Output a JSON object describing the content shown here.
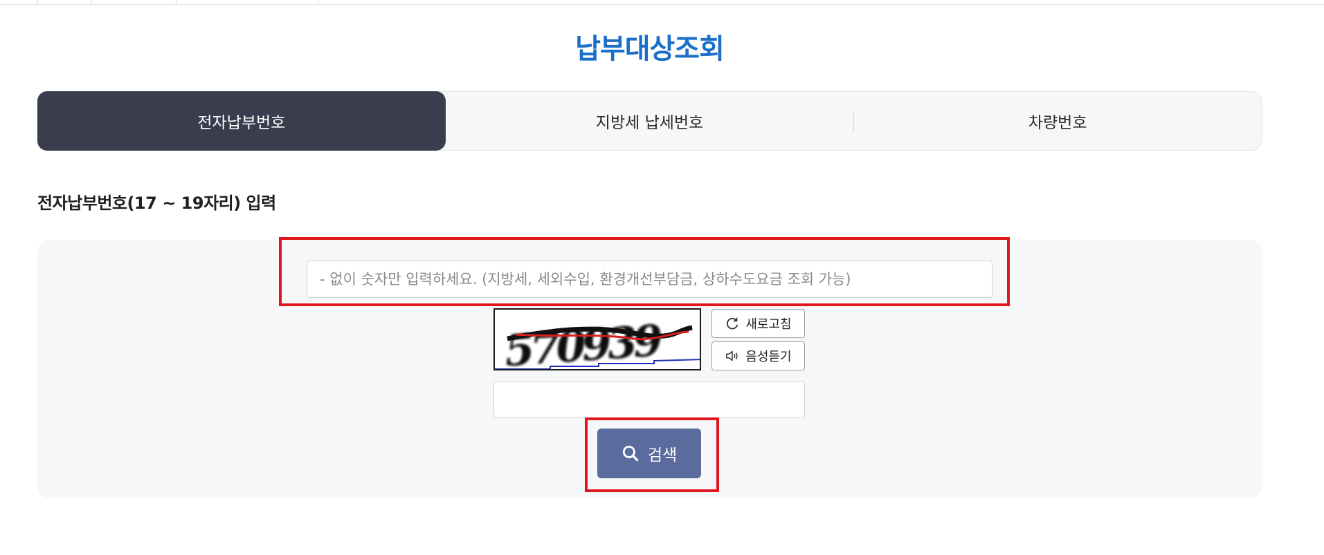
{
  "page": {
    "title": "납부대상조회"
  },
  "tabs": [
    {
      "label": "전자납부번호",
      "active": true
    },
    {
      "label": "지방세 납세번호",
      "active": false
    },
    {
      "label": "차량번호",
      "active": false
    }
  ],
  "form": {
    "section_label": "전자납부번호(17 ~ 19자리) 입력",
    "number_input": {
      "placeholder": "- 없이 숫자만 입력하세요. (지방세, 세외수입, 환경개선부담금, 상하수도요금 조회 가능)",
      "value": ""
    },
    "captcha": {
      "image_text": "570939",
      "refresh_label": "새로고침",
      "refresh_icon": "refresh-icon",
      "audio_label": "음성듣기",
      "audio_icon": "speaker-icon",
      "answer_value": ""
    },
    "search_button": {
      "label": "검색",
      "icon": "search-icon"
    }
  },
  "colors": {
    "title": "#1a6fc8",
    "active_tab": "#3a3d4e",
    "search_button": "#5a6b9d",
    "highlight": "#e0161b"
  }
}
